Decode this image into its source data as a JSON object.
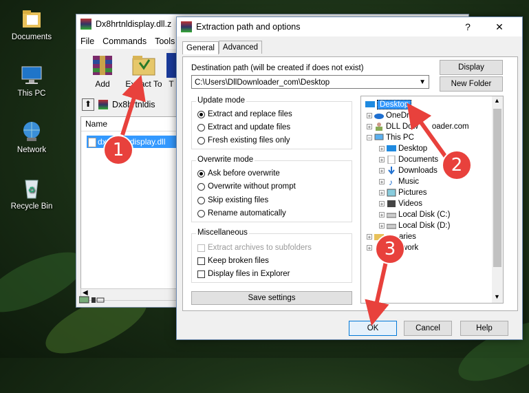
{
  "desktop": {
    "icons": [
      {
        "label": "Documents"
      },
      {
        "label": "This PC"
      },
      {
        "label": "Network"
      },
      {
        "label": "Recycle Bin"
      }
    ]
  },
  "winrar": {
    "title": "Dx8hrtnldisplay.dll.z",
    "menu": [
      "File",
      "Commands",
      "Tools"
    ],
    "toolbar": {
      "add": "Add",
      "extract_to": "Extract To",
      "partial": "T"
    },
    "address": "Dx8hrtnldis",
    "column_name": "Name",
    "file": "display.dll",
    "file_prefix": "dx"
  },
  "dialog": {
    "title": "Extraction path and options",
    "help_glyph": "?",
    "close_glyph": "✕",
    "tabs": [
      "General",
      "Advanced"
    ],
    "dest_label": "Destination path (will be created if does not exist)",
    "dest_value": "C:\\Users\\DllDownloader_com\\Desktop",
    "display_btn": "Display",
    "new_folder_btn": "New Folder",
    "update_mode": {
      "title": "Update mode",
      "options": [
        "Extract and replace files",
        "Extract and update files",
        "Fresh existing files only"
      ],
      "selected": 0
    },
    "overwrite_mode": {
      "title": "Overwrite mode",
      "options": [
        "Ask before overwrite",
        "Overwrite without prompt",
        "Skip existing files",
        "Rename automatically"
      ],
      "selected": 0
    },
    "misc": {
      "title": "Miscellaneous",
      "options": [
        "Extract archives to subfolders",
        "Keep broken files",
        "Display files in Explorer"
      ]
    },
    "save_settings": "Save settings",
    "tree": {
      "desktop": "Desktop",
      "onedrive": "OneDr",
      "dll": "DLL Dow",
      "dll_tail": "oader.com",
      "thispc": "This PC",
      "children": [
        "Desktop",
        "Documents",
        "Downloads",
        "Music",
        "Pictures",
        "Videos",
        "Local Disk (C:)",
        "Local Disk (D:)"
      ],
      "libraries": "aries",
      "network": "work"
    },
    "ok": "OK",
    "cancel": "Cancel",
    "help": "Help"
  },
  "annotations": [
    "1",
    "2",
    "3"
  ],
  "colors": {
    "accent": "#3399ff",
    "badge": "#e8413c"
  }
}
